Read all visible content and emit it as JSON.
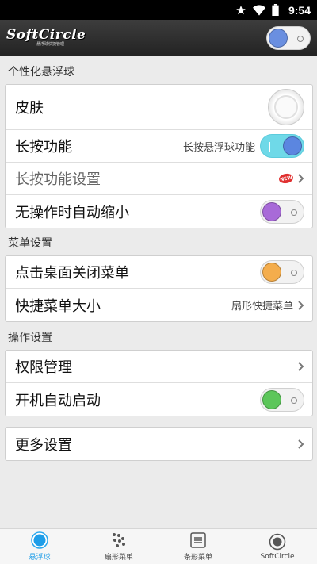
{
  "status_bar": {
    "time": "9:54"
  },
  "app_bar": {
    "logo_text": "SoftCircle",
    "logo_subtext": "悬浮球快捷管理",
    "master_toggle": {
      "on": false,
      "knob_color": "#6a8fe0"
    }
  },
  "sections": [
    {
      "header": "个性化悬浮球"
    },
    {
      "header": "菜单设置"
    },
    {
      "header": "操作设置"
    }
  ],
  "personalize": {
    "skin_label": "皮肤",
    "long_press_label": "长按功能",
    "long_press_hint": "长按悬浮球功能",
    "long_press_toggle": {
      "on": true,
      "knob_color": "#5b86e0"
    },
    "long_press_settings_label": "长按功能设置",
    "new_badge": "NEW",
    "auto_shrink_label": "无操作时自动缩小",
    "auto_shrink_toggle": {
      "on": false,
      "knob_color": "#a86ad8"
    }
  },
  "menu_settings": {
    "tap_desktop_close_label": "点击桌面关闭菜单",
    "tap_desktop_close_toggle": {
      "on": false,
      "knob_color": "#f4ad4c"
    },
    "quick_menu_size_label": "快捷菜单大小",
    "quick_menu_size_value": "扇形快捷菜单"
  },
  "operation_settings": {
    "permission_label": "权限管理",
    "autostart_label": "开机自动启动",
    "autostart_toggle": {
      "on": false,
      "knob_color": "#5cc65a"
    }
  },
  "more": {
    "label": "更多设置"
  },
  "bottom_nav": [
    {
      "label": "悬浮球",
      "icon": "floating-ball-icon",
      "active": true
    },
    {
      "label": "扇形菜单",
      "icon": "fan-menu-icon",
      "active": false
    },
    {
      "label": "条形菜单",
      "icon": "bar-menu-icon",
      "active": false
    },
    {
      "label": "SoftCircle",
      "icon": "softcircle-icon",
      "active": false
    }
  ],
  "colors": {
    "accent": "#1e9de8",
    "toggle_on_track": "#6fd9e8"
  }
}
